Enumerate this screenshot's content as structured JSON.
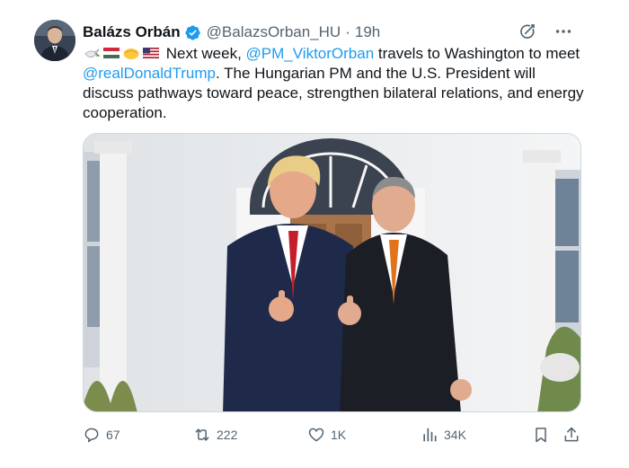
{
  "author": {
    "name": "Balázs Orbán",
    "handle": "@BalazsOrban_HU",
    "separator": "·",
    "time": "19h"
  },
  "tweet": {
    "emojis": [
      "dove-emoji",
      "hungary-flag-emoji",
      "handshake-emoji",
      "usa-flag-emoji"
    ],
    "text_1": " Next week, ",
    "mention_1": "@PM_ViktorOrban",
    "text_2": " travels to Washington to meet ",
    "mention_2": "@realDonaldTrump",
    "text_3": ". The Hungarian PM and the U.S. President will discuss pathways toward peace, strengthen bilateral relations, and energy cooperation."
  },
  "media": {
    "alt": "Two men in dark suits giving thumbs up in front of a white building with an arched doorway"
  },
  "actions": {
    "replies": "67",
    "reposts": "222",
    "likes": "1K",
    "views": "34K"
  },
  "colors": {
    "link": "#1d9bf0",
    "secondary_text": "#536471",
    "verified": "#1d9bf0"
  }
}
